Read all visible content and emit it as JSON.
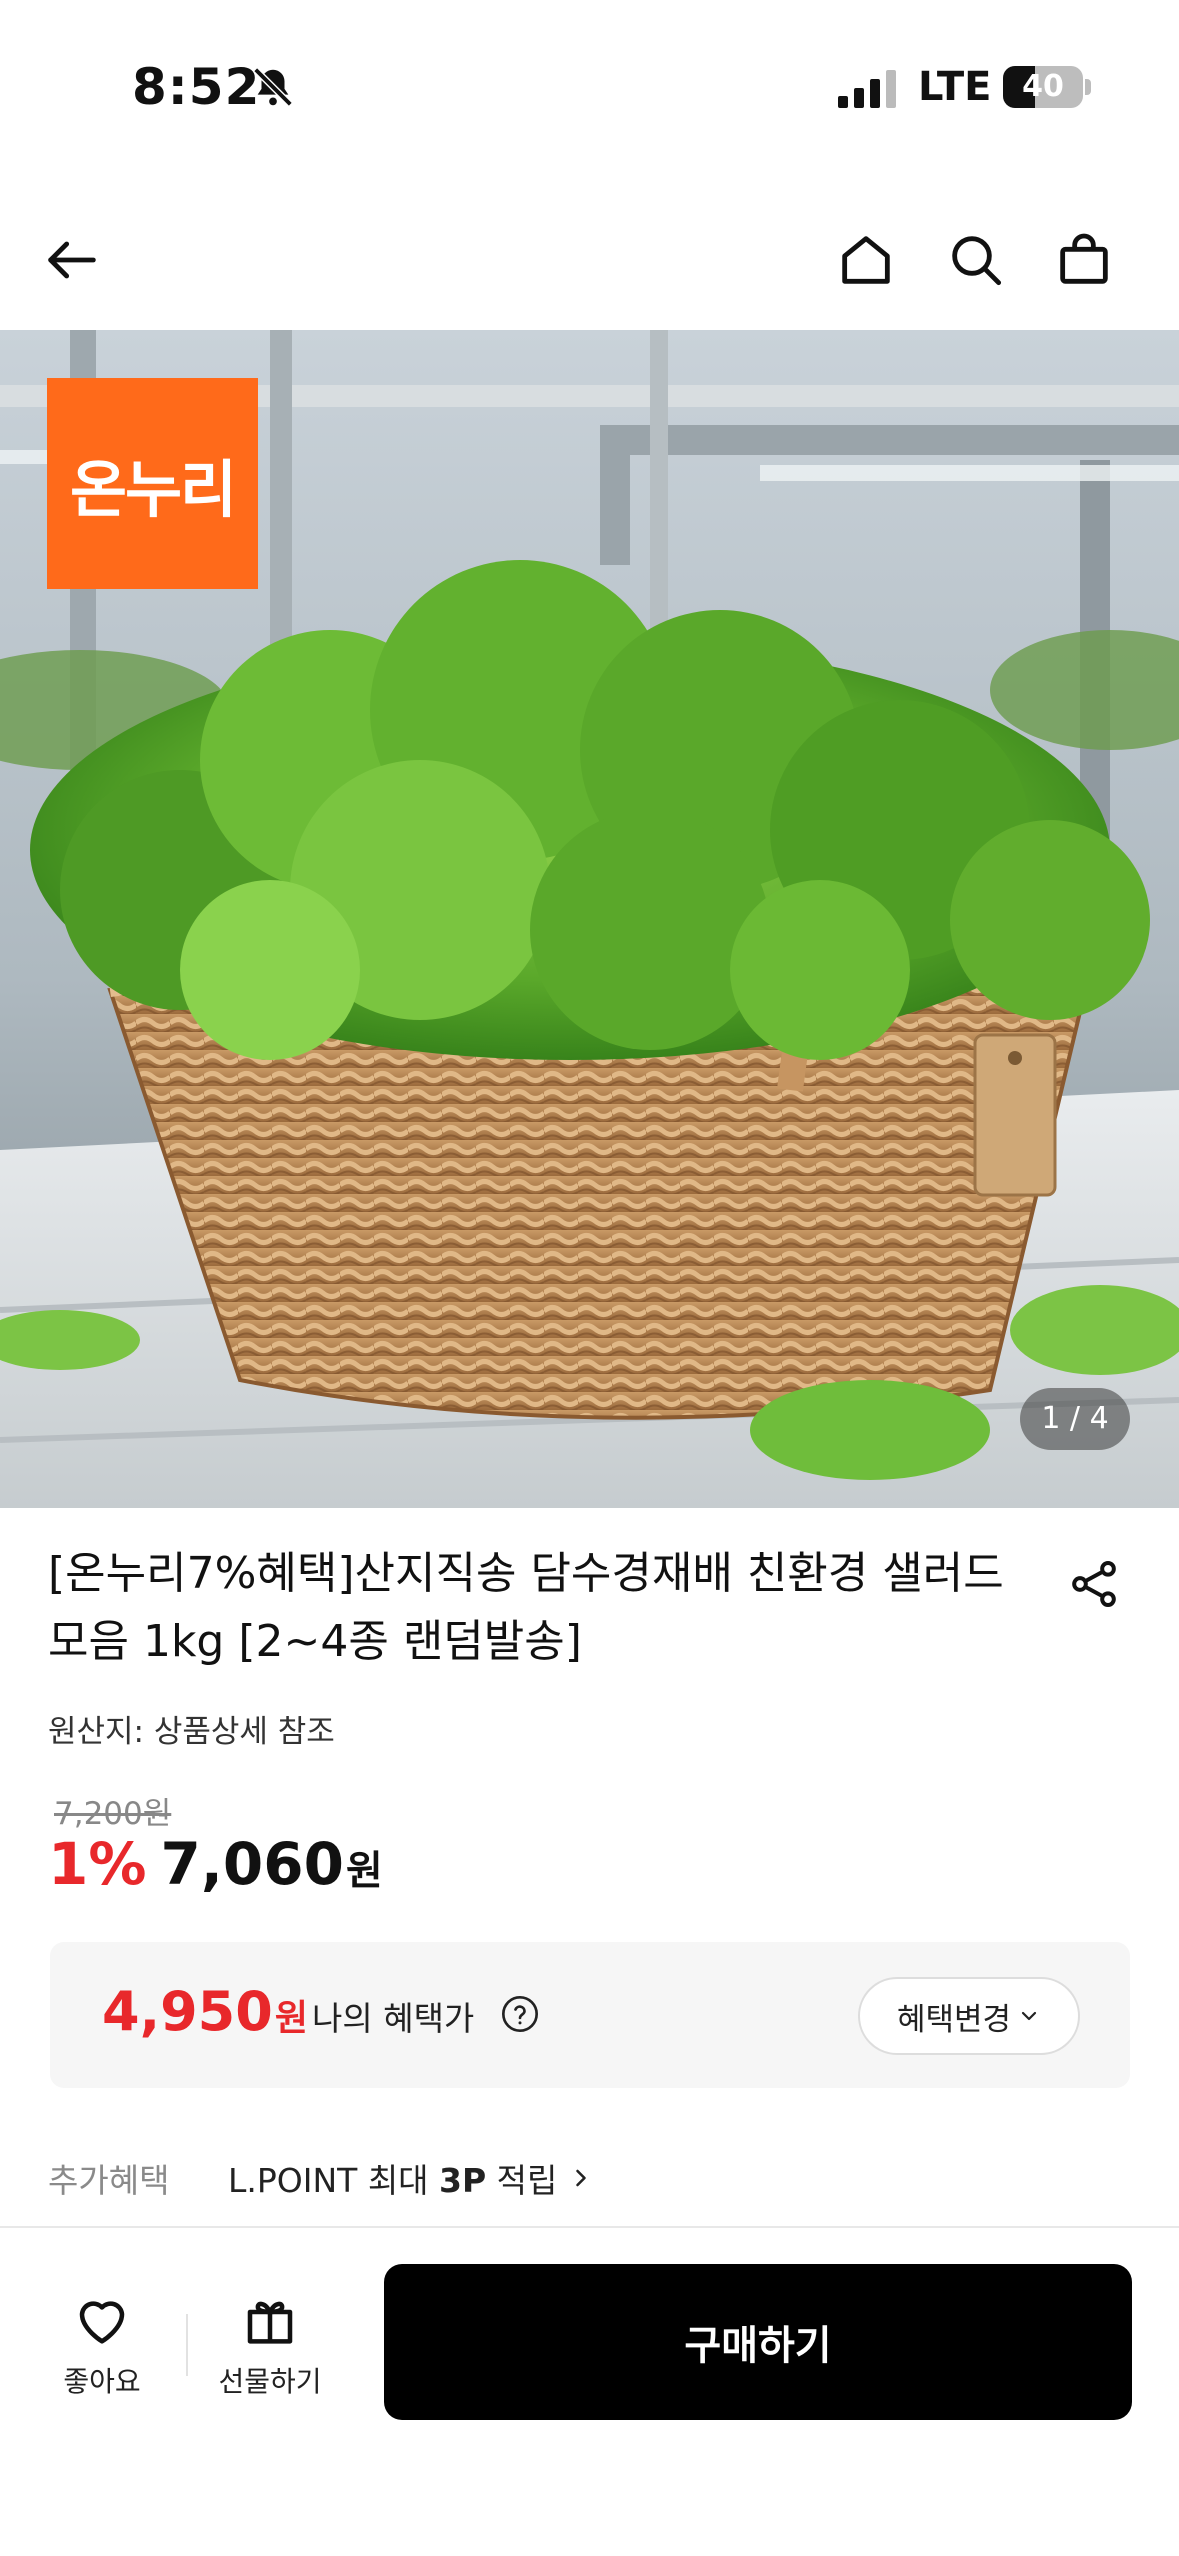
{
  "status_bar": {
    "time": "8:52",
    "network": "LTE",
    "battery": "40",
    "battery_level": 0.4
  },
  "nav": {
    "icons": [
      "back-arrow-icon",
      "home-icon",
      "search-icon",
      "shopping-bag-icon"
    ]
  },
  "hero": {
    "brand_logo_text": "온누리",
    "brand_color": "#ff6a1a",
    "image_counter": "1 / 4"
  },
  "product": {
    "title": "[온누리7%혜택]산지직송 담수경재배 친환경 샐러드 모음 1kg [2~4종 랜덤발송]",
    "origin": "원산지: 상품상세 참조",
    "original_price": "7,200원",
    "discount_rate": "1%",
    "sale_price": "7,060",
    "sale_unit": "원",
    "accent_color": "#e8282b"
  },
  "benefit": {
    "amount": "4,950",
    "unit": "원",
    "label": "나의 혜택가",
    "change_label": "혜택변경"
  },
  "extra_benefit": {
    "label": "추가혜택",
    "text_prefix": "L.POINT 최대 ",
    "points": "3P",
    "text_suffix": " 적립"
  },
  "bottom_bar": {
    "like_label": "좋아요",
    "gift_label": "선물하기",
    "buy_label": "구매하기"
  }
}
